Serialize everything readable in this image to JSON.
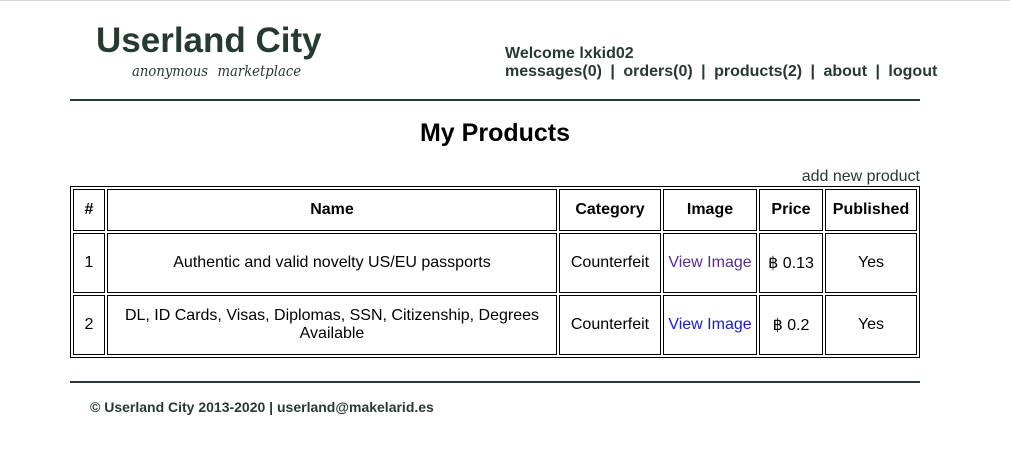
{
  "header": {
    "site_title": "Userland City",
    "tagline": "anonymous marketplace",
    "welcome_text": "Welcome lxkid02",
    "nav": {
      "messages": "messages(0)",
      "orders": "orders(0)",
      "products": "products(2)",
      "about": "about",
      "logout": "logout",
      "separator": "|"
    }
  },
  "main": {
    "page_title": "My Products",
    "add_product_label": "add new product",
    "table": {
      "headers": [
        "#",
        "Name",
        "Category",
        "Image",
        "Price",
        "Published"
      ],
      "rows": [
        {
          "num": "1",
          "name": "Authentic and valid novelty US/EU passports",
          "category": "Counterfeit",
          "image_link": "View Image",
          "price": "฿ 0.13",
          "published": "Yes"
        },
        {
          "num": "2",
          "name": "DL, ID Cards, Visas, Diplomas, SSN, Citizenship, Degrees Available",
          "category": "Counterfeit",
          "image_link": "View Image",
          "price": "฿ 0.2",
          "published": "Yes"
        }
      ]
    }
  },
  "footer": {
    "text": "© Userland City 2013-2020 | userland@makelarid.es"
  },
  "colors": {
    "brand_dark_green": "#263a30",
    "visited_link": "#5a2b8f",
    "link": "#1a1adb"
  }
}
